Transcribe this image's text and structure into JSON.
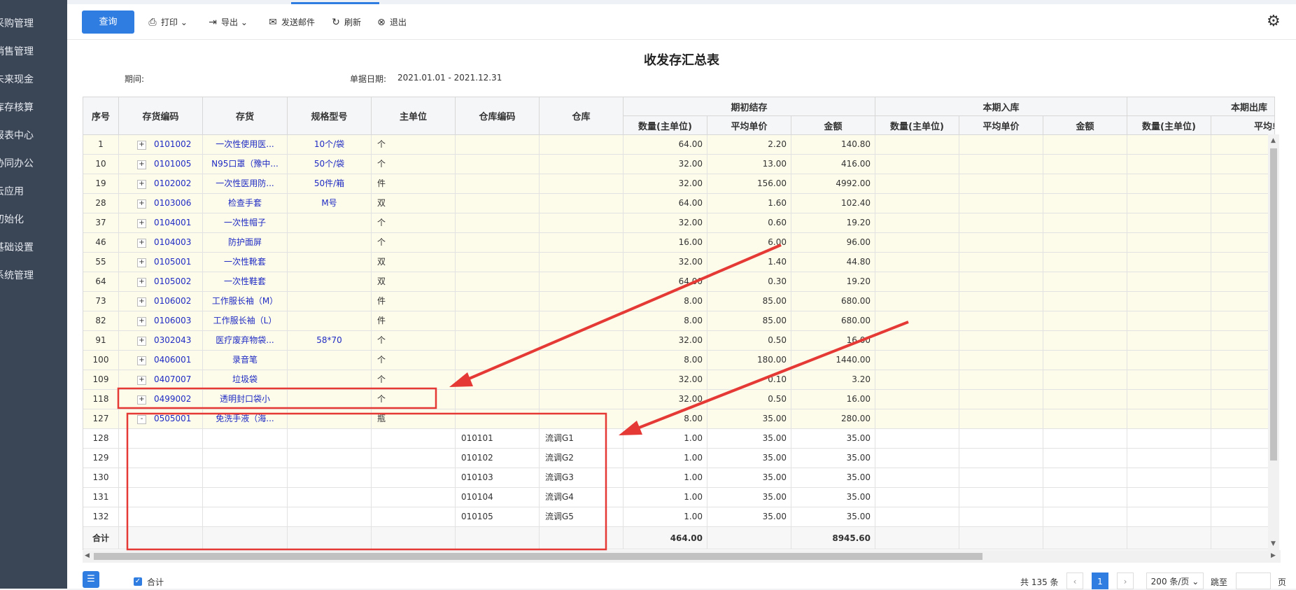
{
  "sidebar": {
    "items": [
      "采购管理",
      "销售管理",
      "未来现金",
      "库存核算",
      "报表中心",
      "协同办公",
      "云应用",
      "初始化",
      "基础设置",
      "系统管理"
    ]
  },
  "toolbar": {
    "query": "查询",
    "print": "打印",
    "export": "导出",
    "email": "发送邮件",
    "refresh": "刷新",
    "exit": "退出"
  },
  "report": {
    "title": "收发存汇总表",
    "period_label": "期间:",
    "date_label": "单据日期:",
    "date_value": "2021.01.01 - 2021.12.31"
  },
  "table": {
    "headers": {
      "seq": "序号",
      "code": "存货编码",
      "item": "存货",
      "spec": "规格型号",
      "unit": "主单位",
      "wh_code": "仓库编码",
      "wh": "仓库",
      "group_open": "期初结存",
      "group_in": "本期入库",
      "group_out": "本期出库",
      "qty": "数量(主单位)",
      "avg": "平均单价",
      "amt": "金额"
    },
    "rows": [
      {
        "seq": "1",
        "exp": "+",
        "code": "0101002",
        "item": "一次性使用医...",
        "spec": "10个/袋",
        "unit": "个",
        "wh_code": "",
        "wh": "",
        "qty": "64.00",
        "avg": "2.20",
        "amt": "140.80",
        "type": "yel"
      },
      {
        "seq": "10",
        "exp": "+",
        "code": "0101005",
        "item": "N95口罩（豫中...",
        "spec": "50个/袋",
        "unit": "个",
        "wh_code": "",
        "wh": "",
        "qty": "32.00",
        "avg": "13.00",
        "amt": "416.00",
        "type": "yel"
      },
      {
        "seq": "19",
        "exp": "+",
        "code": "0102002",
        "item": "一次性医用防...",
        "spec": "50件/箱",
        "unit": "件",
        "wh_code": "",
        "wh": "",
        "qty": "32.00",
        "avg": "156.00",
        "amt": "4992.00",
        "type": "yel"
      },
      {
        "seq": "28",
        "exp": "+",
        "code": "0103006",
        "item": "检查手套",
        "spec": "M号",
        "unit": "双",
        "wh_code": "",
        "wh": "",
        "qty": "64.00",
        "avg": "1.60",
        "amt": "102.40",
        "type": "yel"
      },
      {
        "seq": "37",
        "exp": "+",
        "code": "0104001",
        "item": "一次性帽子",
        "spec": "",
        "unit": "个",
        "wh_code": "",
        "wh": "",
        "qty": "32.00",
        "avg": "0.60",
        "amt": "19.20",
        "type": "yel"
      },
      {
        "seq": "46",
        "exp": "+",
        "code": "0104003",
        "item": "防护面屏",
        "spec": "",
        "unit": "个",
        "wh_code": "",
        "wh": "",
        "qty": "16.00",
        "avg": "6.00",
        "amt": "96.00",
        "type": "yel"
      },
      {
        "seq": "55",
        "exp": "+",
        "code": "0105001",
        "item": "一次性靴套",
        "spec": "",
        "unit": "双",
        "wh_code": "",
        "wh": "",
        "qty": "32.00",
        "avg": "1.40",
        "amt": "44.80",
        "type": "yel"
      },
      {
        "seq": "64",
        "exp": "+",
        "code": "0105002",
        "item": "一次性鞋套",
        "spec": "",
        "unit": "双",
        "wh_code": "",
        "wh": "",
        "qty": "64.00",
        "avg": "0.30",
        "amt": "19.20",
        "type": "yel"
      },
      {
        "seq": "73",
        "exp": "+",
        "code": "0106002",
        "item": "工作服长袖（M）",
        "spec": "",
        "unit": "件",
        "wh_code": "",
        "wh": "",
        "qty": "8.00",
        "avg": "85.00",
        "amt": "680.00",
        "type": "yel"
      },
      {
        "seq": "82",
        "exp": "+",
        "code": "0106003",
        "item": "工作服长袖（L）",
        "spec": "",
        "unit": "件",
        "wh_code": "",
        "wh": "",
        "qty": "8.00",
        "avg": "85.00",
        "amt": "680.00",
        "type": "yel"
      },
      {
        "seq": "91",
        "exp": "+",
        "code": "0302043",
        "item": "医疗废弃物袋...",
        "spec": "58*70",
        "unit": "个",
        "wh_code": "",
        "wh": "",
        "qty": "32.00",
        "avg": "0.50",
        "amt": "16.00",
        "type": "yel"
      },
      {
        "seq": "100",
        "exp": "+",
        "code": "0406001",
        "item": "录音笔",
        "spec": "",
        "unit": "个",
        "wh_code": "",
        "wh": "",
        "qty": "8.00",
        "avg": "180.00",
        "amt": "1440.00",
        "type": "yel"
      },
      {
        "seq": "109",
        "exp": "+",
        "code": "0407007",
        "item": "垃圾袋",
        "spec": "",
        "unit": "个",
        "wh_code": "",
        "wh": "",
        "qty": "32.00",
        "avg": "0.10",
        "amt": "3.20",
        "type": "yel"
      },
      {
        "seq": "118",
        "exp": "+",
        "code": "0499002",
        "item": "透明封口袋小",
        "spec": "",
        "unit": "个",
        "wh_code": "",
        "wh": "",
        "qty": "32.00",
        "avg": "0.50",
        "amt": "16.00",
        "type": "yel"
      },
      {
        "seq": "127",
        "exp": "-",
        "code": "0505001",
        "item": "免洗手液（海...",
        "spec": "",
        "unit": "瓶",
        "wh_code": "",
        "wh": "",
        "qty": "8.00",
        "avg": "35.00",
        "amt": "280.00",
        "type": "yel"
      },
      {
        "seq": "128",
        "exp": "",
        "code": "",
        "item": "",
        "spec": "",
        "unit": "",
        "wh_code": "010101",
        "wh": "流调G1",
        "qty": "1.00",
        "avg": "35.00",
        "amt": "35.00",
        "type": "wht"
      },
      {
        "seq": "129",
        "exp": "",
        "code": "",
        "item": "",
        "spec": "",
        "unit": "",
        "wh_code": "010102",
        "wh": "流调G2",
        "qty": "1.00",
        "avg": "35.00",
        "amt": "35.00",
        "type": "wht"
      },
      {
        "seq": "130",
        "exp": "",
        "code": "",
        "item": "",
        "spec": "",
        "unit": "",
        "wh_code": "010103",
        "wh": "流调G3",
        "qty": "1.00",
        "avg": "35.00",
        "amt": "35.00",
        "type": "wht"
      },
      {
        "seq": "131",
        "exp": "",
        "code": "",
        "item": "",
        "spec": "",
        "unit": "",
        "wh_code": "010104",
        "wh": "流调G4",
        "qty": "1.00",
        "avg": "35.00",
        "amt": "35.00",
        "type": "wht"
      },
      {
        "seq": "132",
        "exp": "",
        "code": "",
        "item": "",
        "spec": "",
        "unit": "",
        "wh_code": "010105",
        "wh": "流调G5",
        "qty": "1.00",
        "avg": "35.00",
        "amt": "35.00",
        "type": "wht"
      }
    ],
    "total": {
      "label": "合计",
      "qty": "464.00",
      "amt": "8945.60"
    }
  },
  "footer": {
    "total_check_label": "合计",
    "count_text": "共 135 条",
    "current_page": "1",
    "page_size": "200 条/页",
    "jump_label": "跳至",
    "page_suffix": "页"
  },
  "annotation_color": "#e53935"
}
